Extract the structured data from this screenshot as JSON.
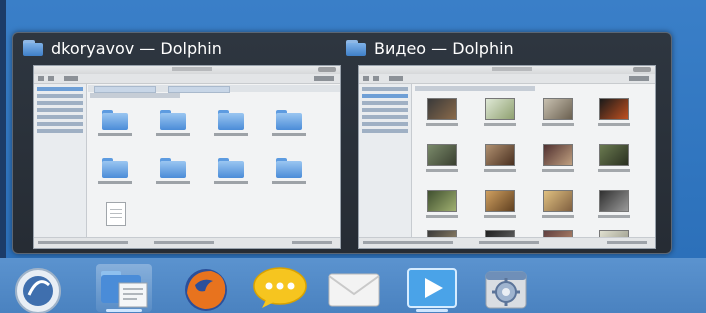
{
  "switcher": {
    "windows": [
      {
        "title": "dkoryavov — Dolphin",
        "icon": "folder-icon"
      },
      {
        "title": "Видео — Dolphin",
        "icon": "folder-icon"
      }
    ]
  },
  "dock": {
    "items": [
      {
        "name": "kde-launcher-icon"
      },
      {
        "name": "dolphin-file-manager-icon",
        "active": true
      },
      {
        "name": "firefox-icon"
      },
      {
        "name": "chat-bubble-icon"
      },
      {
        "name": "mail-envelope-icon"
      },
      {
        "name": "media-player-icon",
        "active": true
      },
      {
        "name": "system-settings-icon"
      }
    ]
  },
  "colors": {
    "desktop": "#2f74be",
    "switcher_bg": "#2a3038",
    "dock_bg": "#5089c8",
    "folder_blue": "#5d9be0"
  }
}
